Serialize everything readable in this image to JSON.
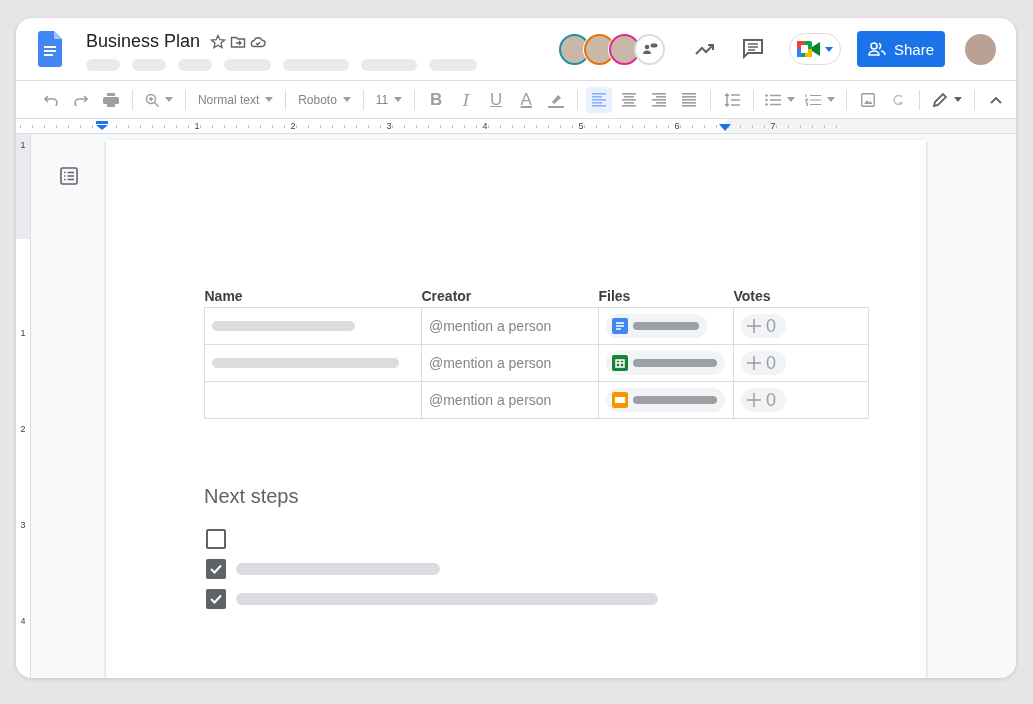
{
  "header": {
    "title": "Business Plan",
    "collaborators": [
      {
        "color": "#1a8fb0"
      },
      {
        "color": "#e37400"
      },
      {
        "color": "#e52592"
      }
    ],
    "share_label": "Share"
  },
  "toolbar": {
    "style": "Normal text",
    "font": "Roboto",
    "size": "11",
    "format_buttons": [
      {
        "kind": "bold",
        "label": "B"
      },
      {
        "kind": "italic",
        "label": "I"
      },
      {
        "kind": "underline",
        "label": "U"
      },
      {
        "kind": "color",
        "label": "A"
      }
    ],
    "alignments": [
      {
        "kind": "left",
        "selected": true
      },
      {
        "kind": "center",
        "selected": false
      },
      {
        "kind": "right",
        "selected": false
      },
      {
        "kind": "justify",
        "selected": false
      }
    ]
  },
  "ruler": {
    "numbers": [
      "1",
      "2",
      "3",
      "4",
      "5",
      "6",
      "7"
    ]
  },
  "vertical_ruler": {
    "numbers": [
      "1",
      "1",
      "2",
      "3",
      "4"
    ]
  },
  "table": {
    "columns": [
      "Name",
      "Creator",
      "Files",
      "Votes"
    ],
    "rows": [
      {
        "name": {
          "kind": "short"
        },
        "creator": "@mention a person",
        "file": {
          "kind": "doc"
        },
        "votes": "0"
      },
      {
        "name": {
          "kind": "long"
        },
        "creator": "@mention a person",
        "file": {
          "kind": "sheet"
        },
        "votes": "0"
      },
      {
        "name": {
          "kind": "none"
        },
        "creator": "@mention a person",
        "file": {
          "kind": "slides"
        },
        "votes": "0"
      }
    ]
  },
  "next_steps": {
    "heading": "Next steps",
    "items": [
      {
        "kind": "empty",
        "checked": false
      },
      {
        "kind": "short",
        "checked": true
      },
      {
        "kind": "long",
        "checked": true
      }
    ]
  }
}
